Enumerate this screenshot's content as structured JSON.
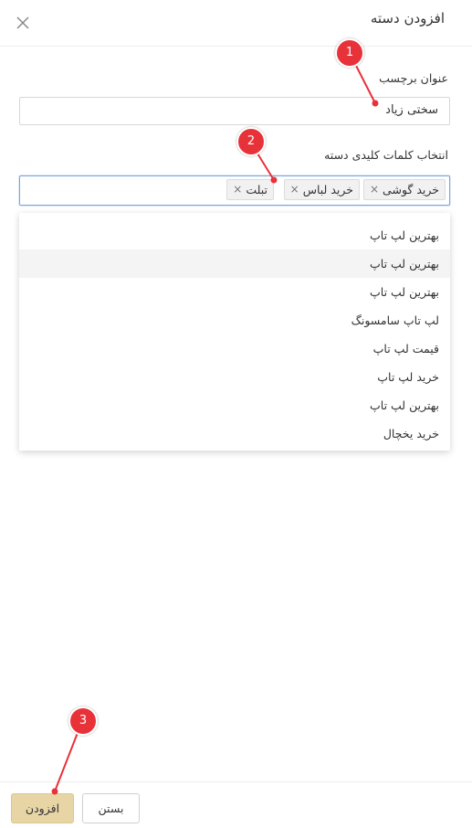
{
  "header": {
    "title": "افزودن دسته",
    "close_icon": "close-icon"
  },
  "form": {
    "tag_title_label": "عنوان برچسب",
    "tag_title_value": "سختی زیاد",
    "keywords_label": "انتخاب کلمات کلیدی دسته",
    "selected_tags": [
      {
        "label": "خرید گوشی",
        "remove": "×"
      },
      {
        "label": "خرید لباس",
        "remove": "×"
      },
      {
        "label": "تبلت",
        "remove": "×"
      }
    ]
  },
  "dropdown": {
    "options": [
      "بهترین لپ تاپ",
      "بهترین لپ تاپ",
      "بهترین لپ تاپ",
      "لپ تاپ سامسونگ",
      "قیمت لپ تاپ",
      "خرید لپ تاپ",
      "بهترین لپ تاپ",
      "خرید یخچال"
    ],
    "highlighted_index": 1
  },
  "footer": {
    "add_label": "افزودن",
    "close_label": "بستن"
  },
  "annotations": [
    "1",
    "2",
    "3"
  ],
  "colors": {
    "annotation": "#e8323a",
    "primary_button": "#e8d5a6",
    "focus_border": "#7aa7de"
  }
}
